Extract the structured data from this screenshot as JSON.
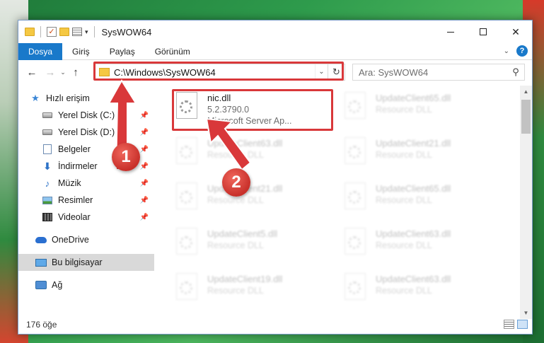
{
  "window": {
    "title": "SysWOW64",
    "controls": {
      "minimize": "",
      "maximize": "",
      "close": "✕"
    }
  },
  "ribbon": {
    "tabs": [
      "Dosya",
      "Giriş",
      "Paylaş",
      "Görünüm"
    ],
    "help": "?"
  },
  "nav": {
    "back": "←",
    "forward": "→",
    "recent": "⌄",
    "up": "↑",
    "address": "C:\\Windows\\SysWOW64",
    "search_placeholder": "Ara: SysWOW64"
  },
  "sidebar": {
    "items": [
      {
        "label": "Hızlı erişim",
        "icon": "star-icon"
      },
      {
        "label": "Yerel Disk (C:)",
        "icon": "disk-icon",
        "pinned": true
      },
      {
        "label": "Yerel Disk (D:)",
        "icon": "disk-icon",
        "pinned": true
      },
      {
        "label": "Belgeler",
        "icon": "documents-icon",
        "pinned": true
      },
      {
        "label": "İndirmeler",
        "icon": "download-icon",
        "pinned": true
      },
      {
        "label": "Müzik",
        "icon": "music-icon",
        "pinned": true
      },
      {
        "label": "Resimler",
        "icon": "pictures-icon",
        "pinned": true
      },
      {
        "label": "Videolar",
        "icon": "videos-icon",
        "pinned": true
      },
      {
        "label": "OneDrive",
        "icon": "cloud-icon"
      },
      {
        "label": "Bu bilgisayar",
        "icon": "computer-icon",
        "selected": true
      },
      {
        "label": "Ağ",
        "icon": "network-icon"
      }
    ]
  },
  "files": {
    "highlighted": {
      "name": "nic.dll",
      "version": "5.2.3790.0",
      "company": "Microsoft Server Ap..."
    },
    "faded": [
      {
        "name": "UpdateClient65.dll",
        "type": "Resource DLL"
      },
      {
        "name": "UpdateClient63.dll",
        "type": "Resource DLL"
      },
      {
        "name": "UpdateClient21.dll",
        "type": "Resource DLL"
      },
      {
        "name": "UpdateClient21.dll",
        "type": "Resource DLL"
      },
      {
        "name": "UpdateClient65.dll",
        "type": "Resource DLL"
      },
      {
        "name": "UpdateClient5.dll",
        "type": "Resource DLL"
      },
      {
        "name": "UpdateClient63.dll",
        "type": "Resource DLL"
      },
      {
        "name": "UpdateClient19.dll",
        "type": "Resource DLL"
      },
      {
        "name": "UpdateClient63.dll",
        "type": "Resource DLL"
      }
    ]
  },
  "status": {
    "item_count": "176 öğe"
  },
  "annotations": {
    "step1": "1",
    "step2": "2",
    "accent_color": "#d9383a"
  }
}
